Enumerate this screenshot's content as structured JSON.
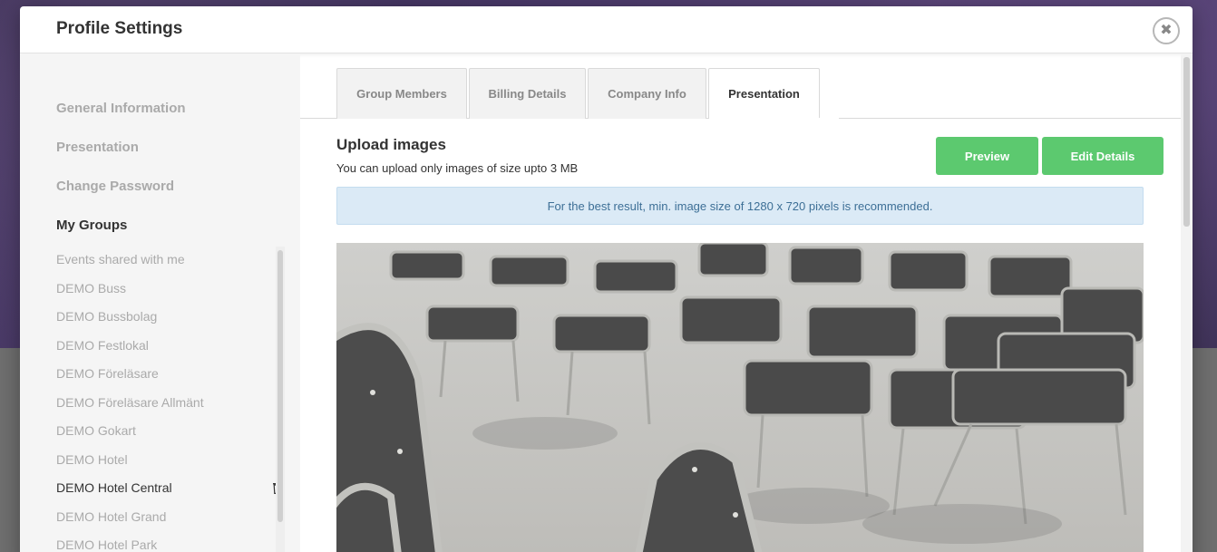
{
  "modal": {
    "title": "Profile Settings",
    "close_label": "✖"
  },
  "sidebar": {
    "nav": [
      {
        "label": "General Information",
        "active": false
      },
      {
        "label": "Presentation",
        "active": false
      },
      {
        "label": "Change Password",
        "active": false
      },
      {
        "label": "My Groups",
        "active": true
      }
    ],
    "groups": [
      {
        "label": "Events shared with me",
        "active": false
      },
      {
        "label": "DEMO Buss",
        "active": false
      },
      {
        "label": "DEMO Bussbolag",
        "active": false
      },
      {
        "label": "DEMO Festlokal",
        "active": false
      },
      {
        "label": "DEMO Föreläsare",
        "active": false
      },
      {
        "label": "DEMO Föreläsare Allmänt",
        "active": false
      },
      {
        "label": "DEMO Gokart",
        "active": false
      },
      {
        "label": "DEMO Hotel",
        "active": false
      },
      {
        "label": "DEMO Hotel Central",
        "active": true,
        "icon": "trash-icon"
      },
      {
        "label": "DEMO Hotel Grand",
        "active": false
      },
      {
        "label": "DEMO Hotel Park",
        "active": false
      }
    ]
  },
  "tabs": [
    {
      "label": "Group Members",
      "active": false
    },
    {
      "label": "Billing Details",
      "active": false
    },
    {
      "label": "Company Info",
      "active": false
    },
    {
      "label": "Presentation",
      "active": true
    }
  ],
  "content": {
    "title": "Upload images",
    "subtitle": "You can upload only images of size upto 3 MB",
    "preview_label": "Preview",
    "edit_label": "Edit Details",
    "info": "For the best result, min. image size of 1280 x 720 pixels is recommended."
  },
  "colors": {
    "accent_green": "#5cc96f",
    "info_bg": "#dbeaf6",
    "info_text": "#3d6f96"
  }
}
